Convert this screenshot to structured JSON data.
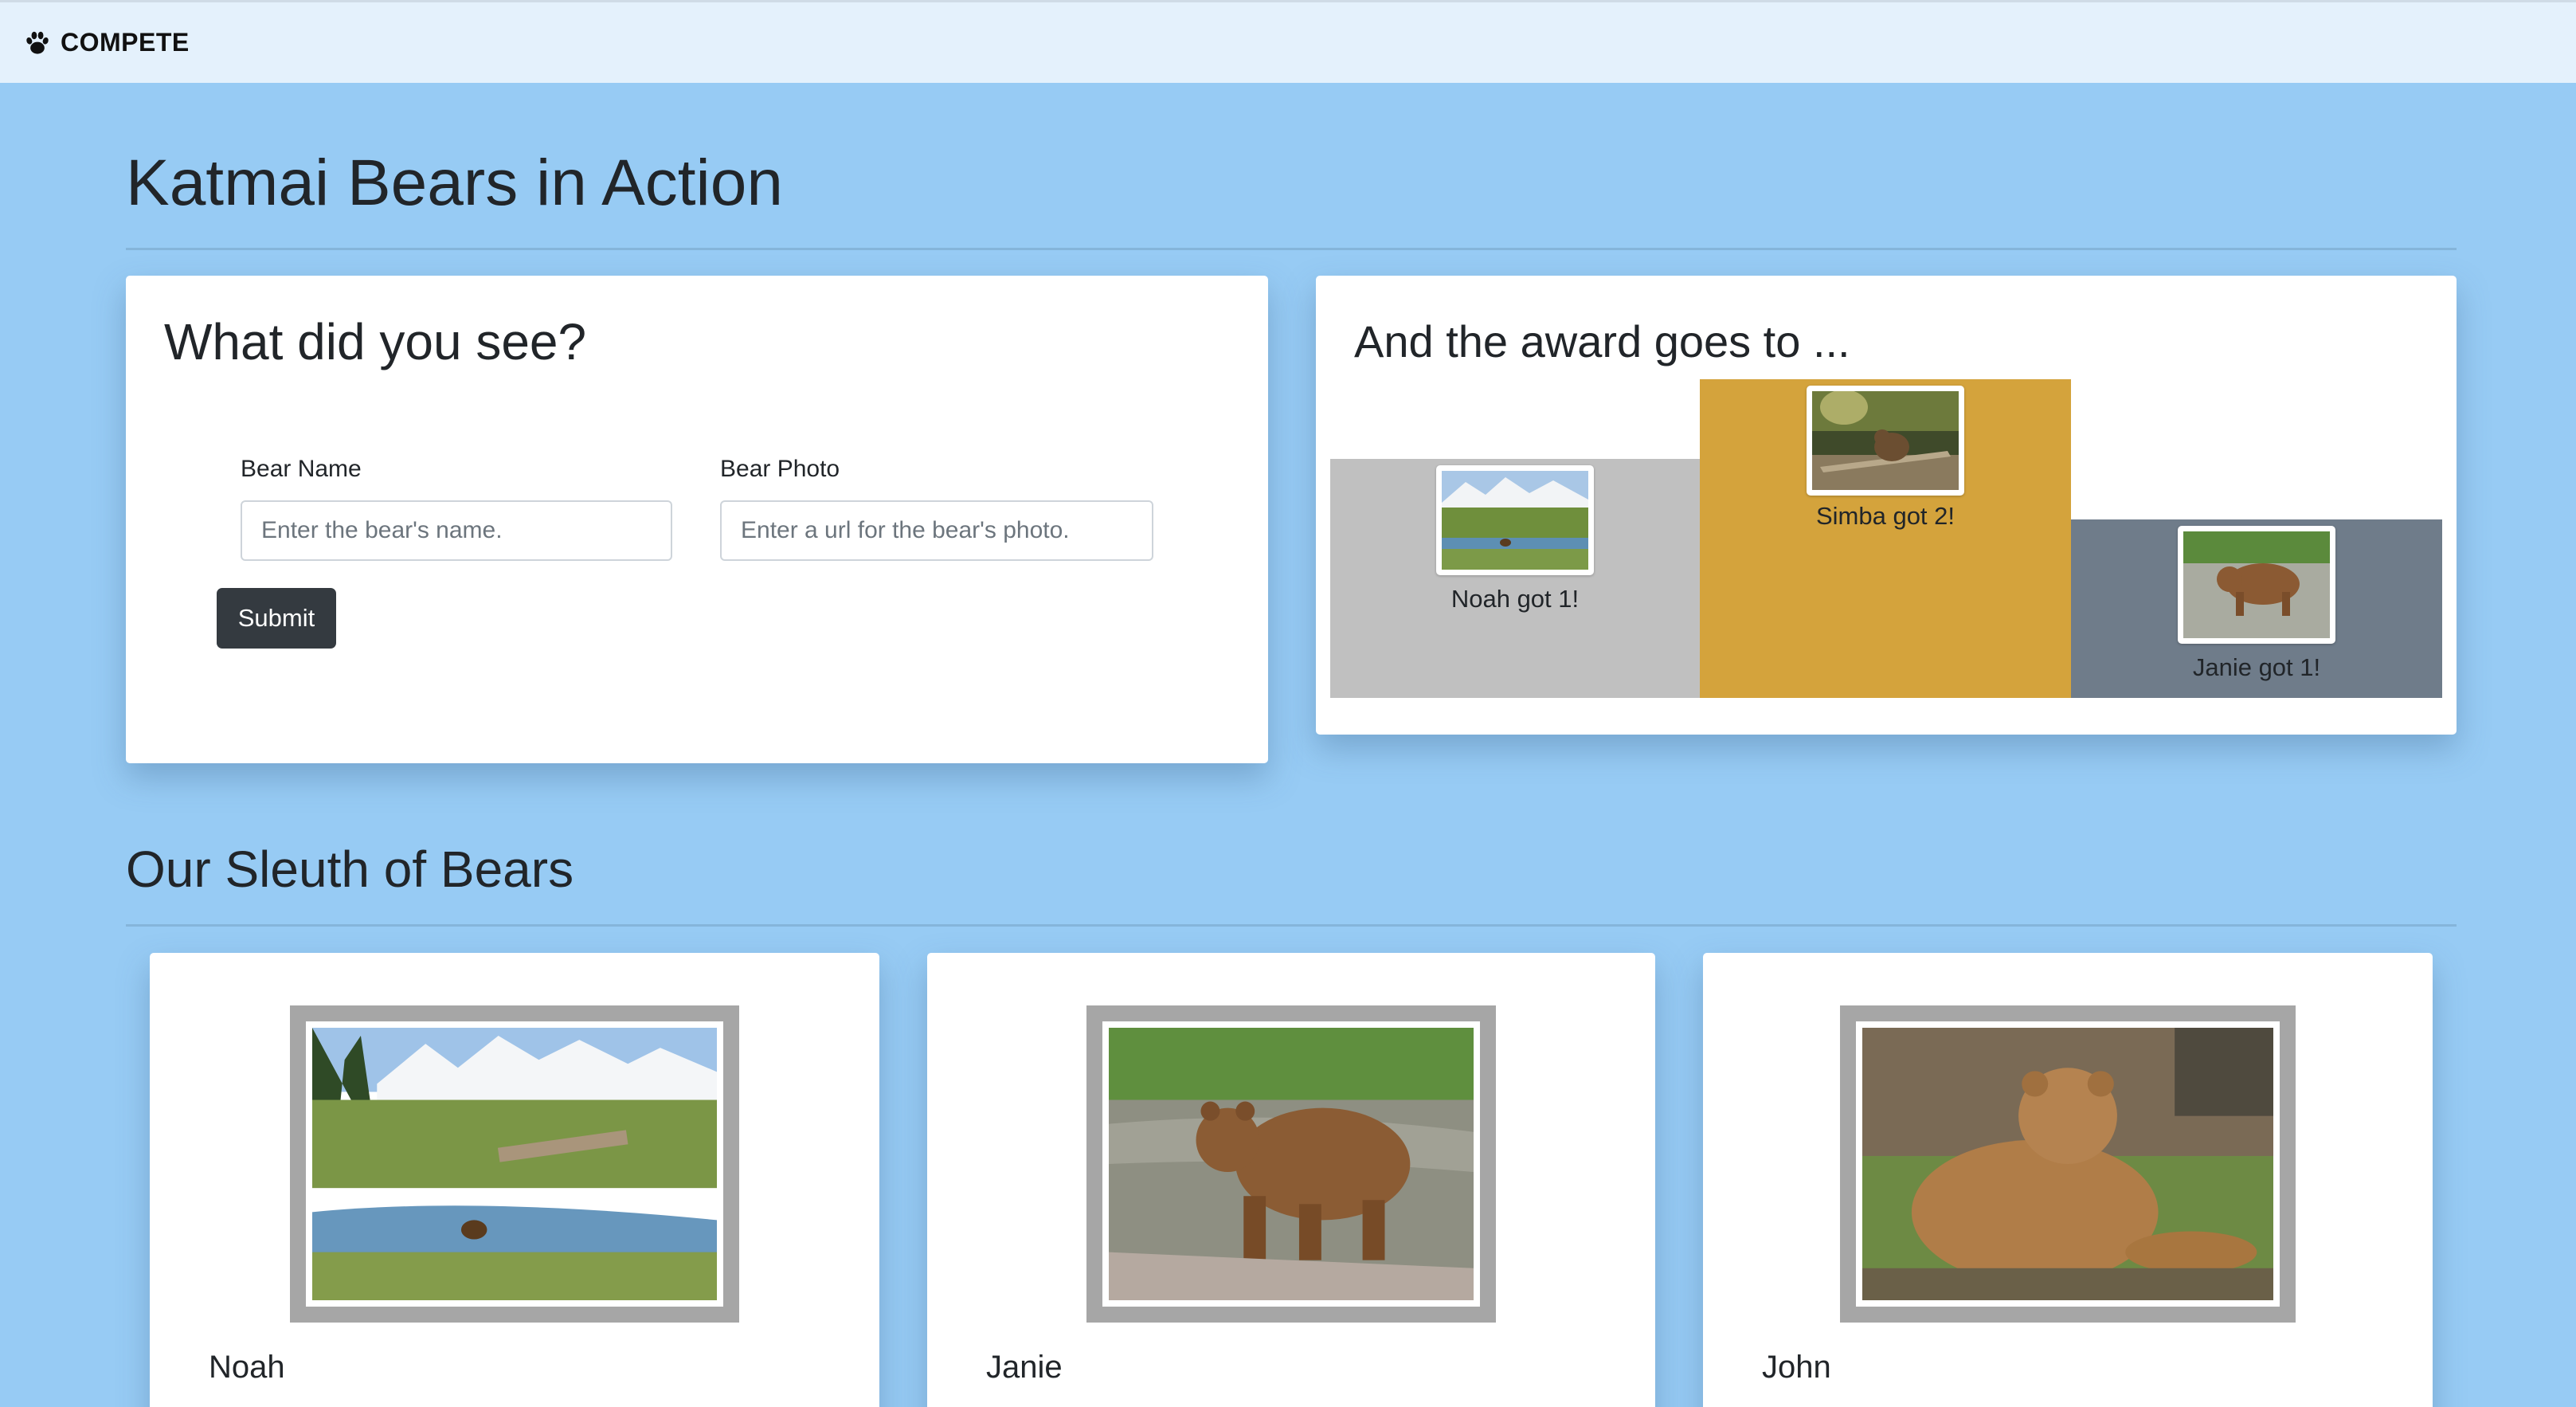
{
  "navbar": {
    "brand": "COMPETE",
    "brand_icon": "paw-icon"
  },
  "page": {
    "title": "Katmai Bears in Action"
  },
  "form": {
    "heading": "What did you see?",
    "name_label": "Bear Name",
    "name_placeholder": "Enter the bear's name.",
    "name_value": "",
    "photo_label": "Bear Photo",
    "photo_placeholder": "Enter a url for the bear's photo.",
    "photo_value": "",
    "submit_label": "Submit"
  },
  "awards": {
    "heading": "And the award goes to ...",
    "podium": [
      {
        "caption": "Noah got 1!",
        "color": "#c0c0c0"
      },
      {
        "caption": "Simba got 2!",
        "color": "#d4a33c"
      },
      {
        "caption": "Janie got 1!",
        "color": "#6f7c8a"
      }
    ]
  },
  "sleuth": {
    "title": "Our Sleuth of Bears",
    "bears": [
      {
        "name": "Noah"
      },
      {
        "name": "Janie"
      },
      {
        "name": "John"
      }
    ]
  },
  "colors": {
    "background": "#97cbf4",
    "navbar": "#e4f1fc",
    "submit": "#343a40",
    "frame": "#a6a6a6"
  }
}
